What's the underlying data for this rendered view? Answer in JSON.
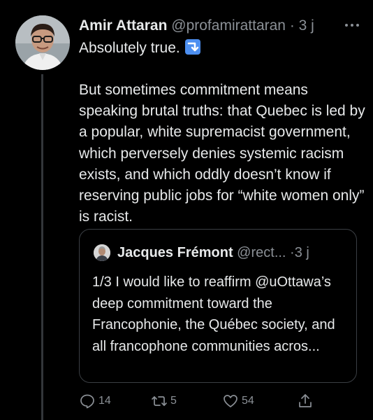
{
  "tweet": {
    "author_name": "Amir Attaran",
    "author_handle": "@profamirattaran",
    "separator": "·",
    "time": "3 j",
    "more_icon": "more-horizontal-icon",
    "first_line": "Absolutely true.",
    "emoji": "arrow-down-right-emoji",
    "body": "But sometimes commitment means speaking brutal truths: that Quebec is led by a popular, white supremacist government, which perversely denies systemic racism exists, and which oddly doesn’t know if reserving public jobs for “white women only” is racist.",
    "quoted": {
      "author_name": "Jacques Frémont",
      "author_handle": "@rect...",
      "separator": "·",
      "time": "3 j",
      "text": "1/3 I would like to reaffirm @uOttawa’s deep commitment toward the Francophonie, the Québec society, and all francophone communities acros..."
    },
    "actions": {
      "reply_count": "14",
      "retweet_count": "5",
      "like_count": "54",
      "reply_icon": "reply-icon",
      "retweet_icon": "retweet-icon",
      "like_icon": "heart-icon",
      "share_icon": "share-icon"
    }
  },
  "colors": {
    "background": "#000000",
    "text_primary": "#e7e9ea",
    "text_secondary": "#8b9096",
    "border": "#3b3f44",
    "emoji_blue": "#4d8ff0"
  }
}
